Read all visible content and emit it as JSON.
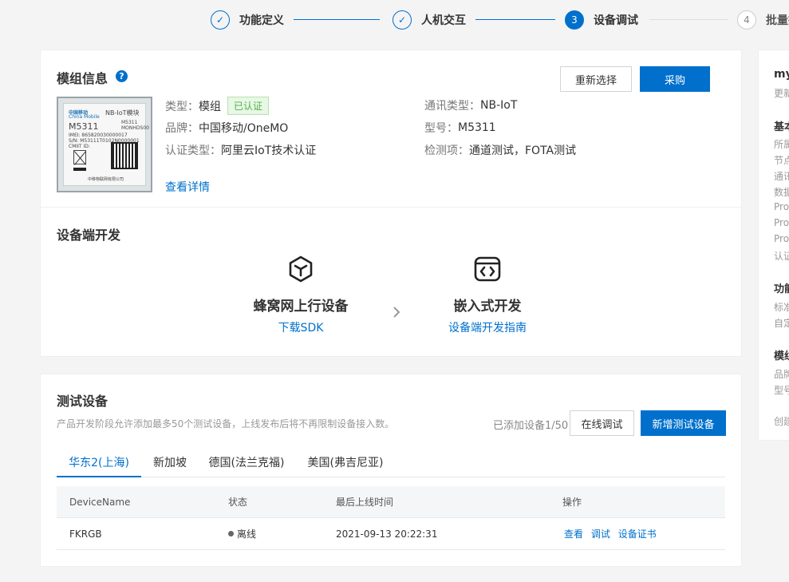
{
  "steps": [
    {
      "index": "✓",
      "label": "功能定义",
      "state": "done"
    },
    {
      "index": "✓",
      "label": "人机交互",
      "state": "done"
    },
    {
      "index": "3",
      "label": "设备调试",
      "state": "active"
    },
    {
      "index": "4",
      "label": "批量投",
      "state": "todo"
    }
  ],
  "module": {
    "title": "模组信息",
    "help_icon": "?",
    "reselect_label": "重新选择",
    "purchase_label": "采购",
    "chip": {
      "brand_cn": "中国移动",
      "brand_en": "China Mobile",
      "kind": "NB-IoT模块",
      "model": "M5311",
      "model_small": "M5311",
      "code": "MONHDS00",
      "imei": "IMEI: 865820030000017",
      "sn": "S/N: M53111T0102N0000001",
      "cmiit": "CMIIT ID:",
      "maker": "中移物联网有限公司"
    },
    "fields_left": [
      {
        "key": "类型：",
        "value": "模组"
      },
      {
        "key": "品牌：",
        "value": "中国移动/OneMO"
      },
      {
        "key": "认证类型：",
        "value": "阿里云IoT技术认证"
      }
    ],
    "certified_badge": "已认证",
    "fields_right": [
      {
        "key": "通讯类型：",
        "value": "NB-IoT"
      },
      {
        "key": "型号：",
        "value": "M5311"
      },
      {
        "key": "检测项：",
        "value": "通道测试，FOTA测试"
      }
    ],
    "details_link": "查看详情"
  },
  "device_dev": {
    "title": "设备端开发",
    "item1": {
      "icon": "cube-icon",
      "title": "蜂窝网上行设备",
      "link": "下载SDK"
    },
    "arrow": "chevron-right-icon",
    "item2": {
      "icon": "code-window-icon",
      "title": "嵌入式开发",
      "link": "设备端开发指南"
    }
  },
  "test_devices": {
    "title": "测试设备",
    "description": "产品开发阶段允许添加最多50个测试设备，上线发布后将不再限制设备接入数。",
    "count_text": "已添加设备1/50",
    "online_debug_label": "在线调试",
    "add_label": "新增测试设备",
    "tabs": [
      "华东2(上海)",
      "新加坡",
      "德国(法兰克福)",
      "美国(弗吉尼亚)"
    ],
    "active_tab": "华东2(上海)",
    "columns": [
      "DeviceName",
      "状态",
      "最后上线时间",
      "操作"
    ],
    "rows": [
      {
        "name": "FKRGB",
        "status": "离线",
        "last_online": "2021-09-13 20:22:31",
        "actions": [
          "查看",
          "调试",
          "设备证书"
        ]
      }
    ]
  },
  "right_panel": {
    "title": "my",
    "subtitle": "更新",
    "section1": "基本",
    "items1": [
      "所属",
      "节点",
      "通讯",
      "数据",
      "Pro",
      "Pro",
      "Pro",
      "认证"
    ],
    "section2": "功能",
    "items2": [
      "标准",
      "自定"
    ],
    "section3": "模组",
    "items3": [
      "品牌",
      "型号"
    ],
    "footer": "创建"
  }
}
